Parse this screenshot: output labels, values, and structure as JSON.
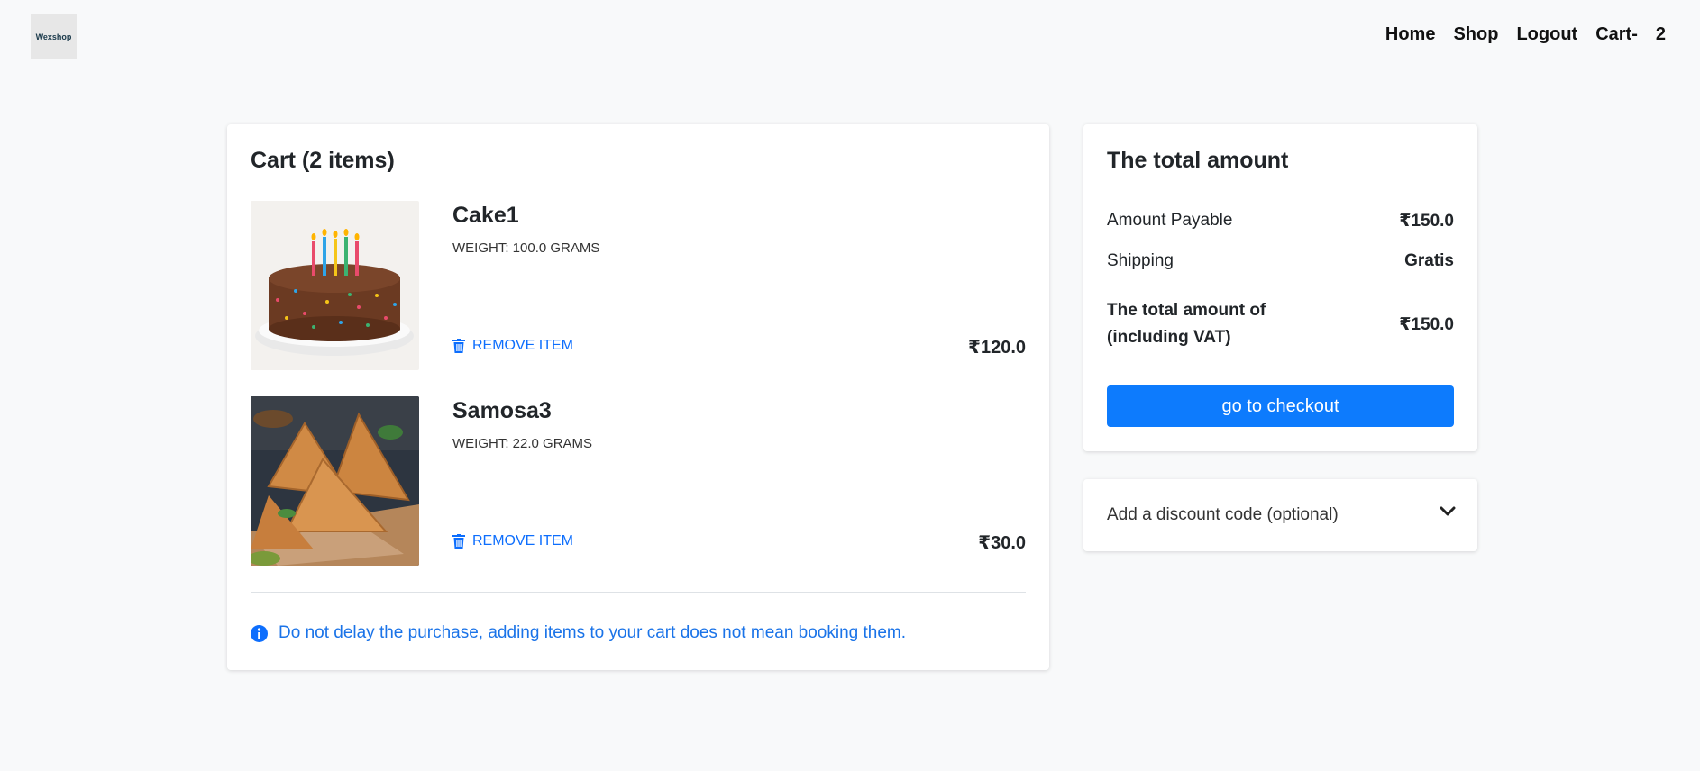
{
  "header": {
    "logo_text": "Wexshop",
    "nav": [
      "Home",
      "Shop",
      "Logout",
      "Cart-"
    ],
    "cart_count": "2"
  },
  "cart": {
    "title": "Cart (2 items)",
    "items": [
      {
        "name": "Cake1",
        "weight": "Weight: 100.0 grams",
        "remove_label": "Remove item",
        "price": "₹120.0"
      },
      {
        "name": "Samosa3",
        "weight": "Weight: 22.0 grams",
        "remove_label": "Remove item",
        "price": "₹30.0"
      }
    ],
    "notice": "Do not delay the purchase, adding items to your cart does not mean booking them."
  },
  "summary": {
    "title": "The total amount",
    "amount_payable_label": "Amount Payable",
    "amount_payable_value": "₹150.0",
    "shipping_label": "Shipping",
    "shipping_value": "Gratis",
    "total_label": "The total amount of (including VAT)",
    "total_value": "₹150.0",
    "checkout_label": "go to checkout"
  },
  "discount": {
    "label": "Add a discount code (optional)"
  },
  "colors": {
    "accent": "#0d7bfd",
    "link": "#0d6efd",
    "background": "#f8f9fa"
  }
}
